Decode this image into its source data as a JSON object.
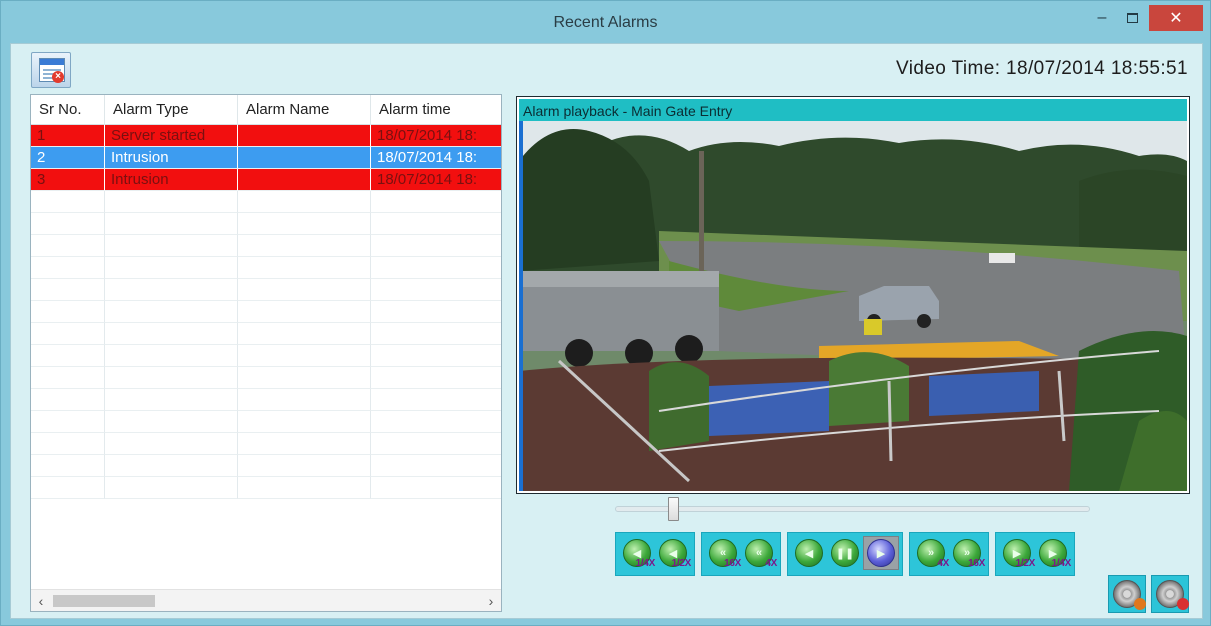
{
  "window": {
    "title": "Recent Alarms",
    "minimize_glyph": "–",
    "close_glyph": "✕"
  },
  "toolbar": {
    "clear_alarms_icon": "document-delete-icon"
  },
  "video_time": {
    "text": "Video Time: 18/07/2014 18:55:51"
  },
  "alarm_table": {
    "columns": [
      "Sr No.",
      "Alarm Type",
      "Alarm Name",
      "Alarm time"
    ],
    "rows": [
      {
        "sr": "1",
        "type": "Server started",
        "name": "",
        "time": "18/07/2014 18:",
        "status": "red"
      },
      {
        "sr": "2",
        "type": "Intrusion",
        "name": "",
        "time": "18/07/2014 18:",
        "status": "blue"
      },
      {
        "sr": "3",
        "type": "Intrusion",
        "name": "",
        "time": "18/07/2014 18:",
        "status": "red"
      }
    ],
    "scroll_left": "‹",
    "scroll_right": "›"
  },
  "player": {
    "title": "Alarm playback - Main Gate Entry",
    "seek_position": 0.11
  },
  "controls": {
    "groups": [
      [
        {
          "icon": "step-back-icon",
          "speed": "1/4X"
        },
        {
          "icon": "step-back-icon",
          "speed": "1/2X"
        }
      ],
      [
        {
          "icon": "rewind-icon",
          "speed": "16X"
        },
        {
          "icon": "rewind-icon",
          "speed": "4X"
        }
      ],
      [
        {
          "icon": "play-reverse-icon",
          "speed": ""
        },
        {
          "icon": "pause-icon",
          "speed": ""
        },
        {
          "icon": "play-icon",
          "speed": "",
          "selected": true
        }
      ],
      [
        {
          "icon": "fast-forward-icon",
          "speed": "4X"
        },
        {
          "icon": "fast-forward-icon",
          "speed": "16X"
        }
      ],
      [
        {
          "icon": "step-forward-icon",
          "speed": "1/2X"
        },
        {
          "icon": "step-forward-icon",
          "speed": "1/4X"
        }
      ]
    ]
  },
  "export_buttons": [
    {
      "icon": "film-reel-export-icon"
    },
    {
      "icon": "film-reel-save-icon"
    }
  ],
  "colors": {
    "alarm_red": "#f20f0f",
    "alarm_blue": "#3d9cf0",
    "player_header": "#1fbec4",
    "window_frame": "#88c9dc"
  }
}
